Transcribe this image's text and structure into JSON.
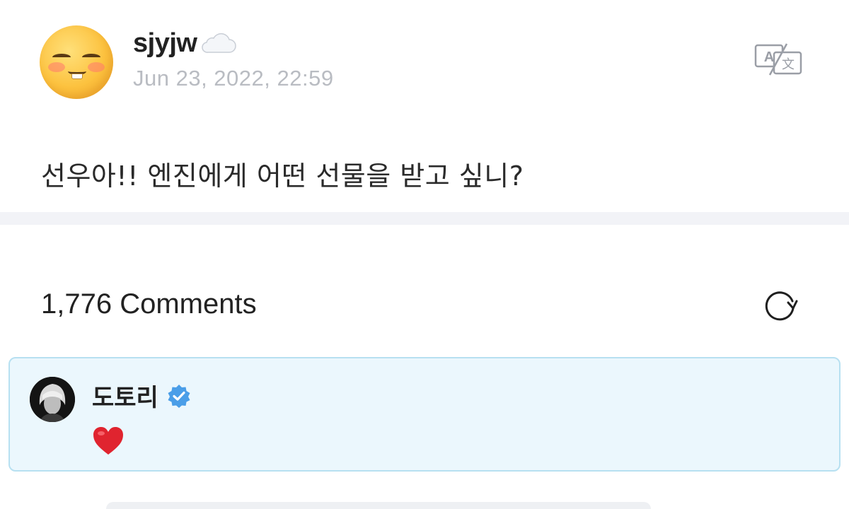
{
  "post": {
    "author": "sjyjw",
    "author_badge_icon": "cloud-icon",
    "avatar_icon": "smiling-face-emoji-icon",
    "date": "Jun 23, 2022, 22:59",
    "body": "선우아!! 엔진에게 어떤 선물을 받고 싶니?",
    "translate_icon": "translate-icon"
  },
  "comments": {
    "count_label": "1,776 Comments",
    "refresh_icon": "refresh-icon",
    "items": [
      {
        "author": "도토리",
        "verified": true,
        "verified_icon": "verified-badge-icon",
        "body_icon": "red-heart-emoji-icon"
      }
    ]
  },
  "colors": {
    "highlight_bg": "#ebf7fd",
    "highlight_border": "#b7e0f1",
    "verified_blue": "#4a9ee8",
    "muted_text": "#b9bcc2"
  }
}
